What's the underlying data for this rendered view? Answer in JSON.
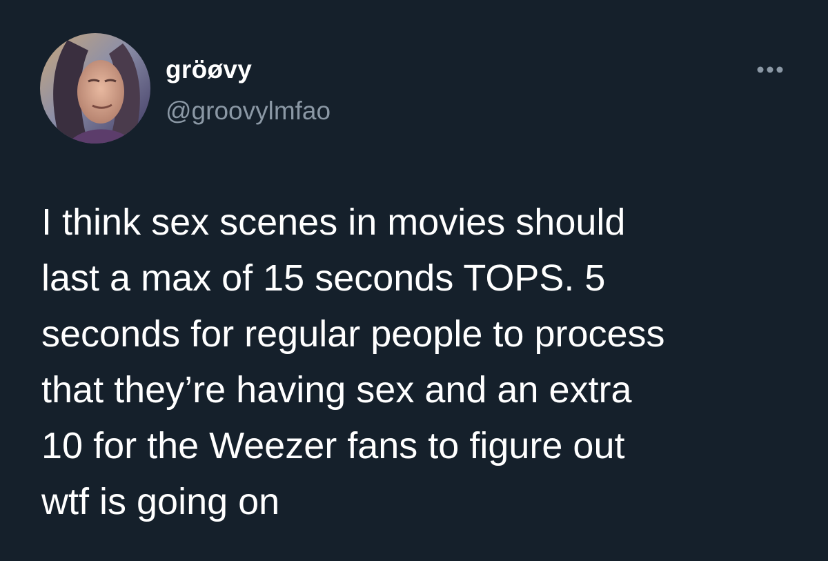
{
  "author": {
    "display_name": "gröøvy",
    "handle": "@groovylmfao",
    "avatar_icon": "profile-photo"
  },
  "more_icon": "ellipsis-icon",
  "tweet": {
    "lines": [
      "I think sex scenes in movies should",
      "last a max of 15 seconds TOPS. 5",
      "seconds for regular people to process",
      "that they’re having sex and an extra",
      "10 for the Weezer fans to figure out",
      "wtf is going on"
    ]
  },
  "colors": {
    "background": "#15202b",
    "primary_text": "#ffffff",
    "secondary_text": "#8b98a5"
  }
}
